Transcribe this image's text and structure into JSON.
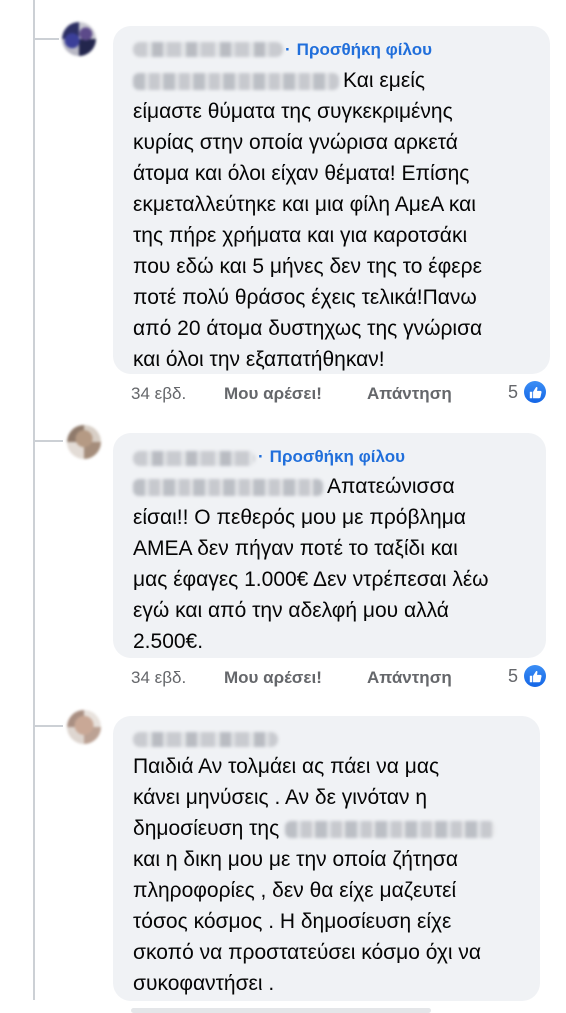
{
  "comments": [
    {
      "add_friend": "Προσθήκη φίλου",
      "first_line_text": "Και εμείς",
      "lines": [
        "είμαστε θύματα της συγκεκριμένης",
        "κυρίας στην οποία γνώρισα αρκετά",
        "άτομα και όλοι είχαν θέματα! Επίσης",
        "εκμεταλλεύτηκε και μια φίλη ΑμεΑ και",
        "της πήρε χρήματα και για καροτσάκι",
        "που εδώ και 5 μήνες δεν της το έφερε",
        "ποτέ πολύ θράσος έχεις τελικά!Πανω",
        "από 20 άτομα δυστηχως της γνώρισα",
        "και όλοι την εξαπατήθηκαν!"
      ],
      "time": "34 εβδ.",
      "like_label": "Μου αρέσει!",
      "reply_label": "Απάντηση",
      "reaction_count": "5",
      "reaction_icon": "like-icon"
    },
    {
      "add_friend": "Προσθήκη φίλου",
      "first_line_text": "Απατεώνισσα",
      "lines": [
        "είσαι!! Ο πεθερός μου με πρόβλημα",
        "ΑΜΕΑ δεν πήγαν ποτέ το ταξίδι και",
        "μας έφαγες 1.000€ Δεν ντρέπεσαι λέω",
        "εγώ και από την αδελφή μου αλλά",
        "2.500€."
      ],
      "time": "34 εβδ.",
      "like_label": "Μου αρέσει!",
      "reply_label": "Απάντηση",
      "reaction_count": "5",
      "reaction_icon": "like-icon"
    },
    {
      "lines": [
        "Παιδιά Αν τολμάει ας πάει να μας",
        "κάνει μηνύσεις . Αν δε γινόταν η"
      ],
      "line3_prefix": "δημοσίευση της",
      "lines_after": [
        "και η δικη μου με την οποία ζήτησα",
        "πληροφορίες , δεν θα είχε μαζευτεί",
        "τόσος κόσμος . Η δημοσίευση είχε",
        "σκοπό να προστατεύσει κόσμο  όχι να",
        "συκοφαντήσει ."
      ]
    }
  ],
  "colors": {
    "link": "#216fdb",
    "bubble": "#f0f2f5",
    "meta": "#65676b",
    "like_badge": "#1466e6"
  }
}
